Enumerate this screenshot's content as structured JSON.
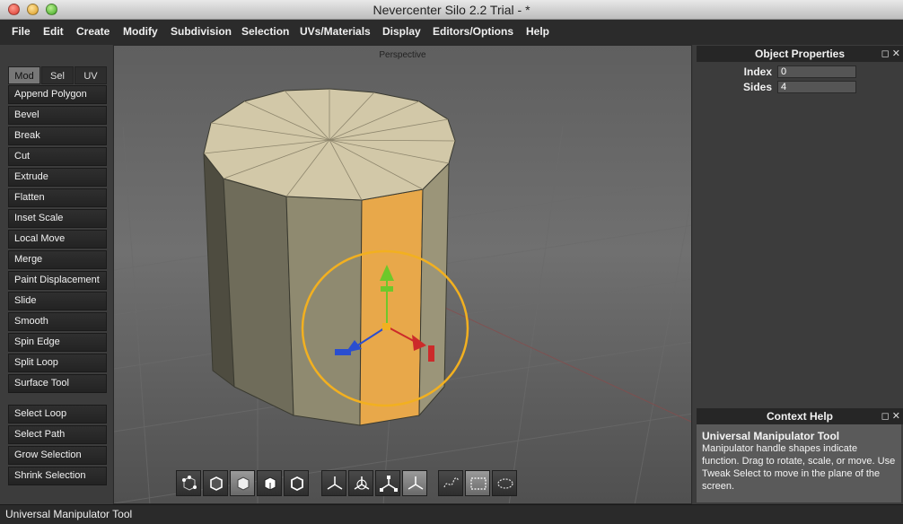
{
  "window": {
    "title": "Nevercenter Silo 2.2 Trial - *"
  },
  "menu": [
    "File",
    "Edit",
    "Create",
    "Modify",
    "Subdivision",
    "Selection",
    "UVs/Materials",
    "Display",
    "Editors/Options",
    "Help"
  ],
  "left_panel": {
    "tabs": [
      "Mod",
      "Sel",
      "UV"
    ],
    "active_tab": "Mod",
    "tools": [
      "Append Polygon",
      "Bevel",
      "Break",
      "Cut",
      "Extrude",
      "Flatten",
      "Inset Scale",
      "Local Move",
      "Merge",
      "Paint Displacement",
      "Slide",
      "Smooth",
      "Spin Edge",
      "Split Loop",
      "Surface Tool"
    ],
    "selection_tools": [
      "Select Loop",
      "Select Path",
      "Grow Selection",
      "Shrink Selection"
    ]
  },
  "viewport": {
    "label": "Perspective"
  },
  "toolbar": {
    "icons": [
      "vertex-select-icon",
      "edge-select-icon",
      "face-select-icon",
      "object-select-icon",
      "object-mode-icon",
      "manipulator-move-icon",
      "manipulator-rotate-icon",
      "manipulator-scale-icon",
      "manipulator-universal-icon",
      "lasso-select-icon",
      "rect-select-icon",
      "paint-select-icon"
    ],
    "active": [
      "face-select-icon",
      "manipulator-universal-icon",
      "rect-select-icon"
    ]
  },
  "object_properties": {
    "title": "Object Properties",
    "rows": [
      {
        "label": "Index",
        "value": "0"
      },
      {
        "label": "Sides",
        "value": "4"
      }
    ]
  },
  "context_help": {
    "title": "Context Help",
    "heading": "Universal Manipulator Tool",
    "body": "Manipulator handle shapes indicate function. Drag to rotate, scale, or move. Use Tweak Select to move in the plane of the screen."
  },
  "status": {
    "text": "Universal Manipulator Tool"
  },
  "colors": {
    "highlight_face": "#e8a84a",
    "gizmo_ring": "#f2b020",
    "axis_x": "#cc2a2a",
    "axis_y": "#6ec82a",
    "axis_z": "#2a4ed0"
  }
}
